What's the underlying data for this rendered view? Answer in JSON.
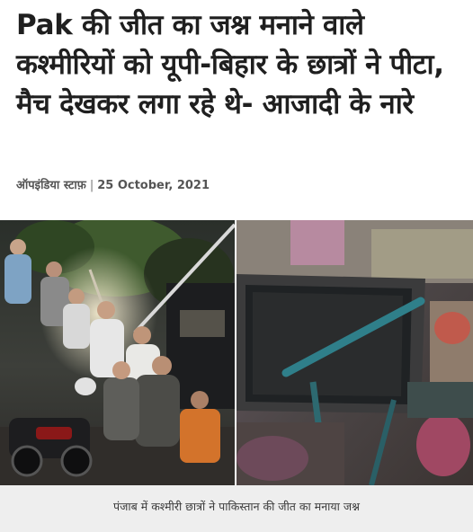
{
  "article": {
    "headline": "Pak की जीत का जश्न मनाने वाले कश्मीरियों को यूपी-बिहार के छात्रों ने पीटा, मैच देखकर लगा रहे थे- आजादी के नारे",
    "author": "ऑपइंडिया स्टाफ़",
    "separator": "|",
    "date": "25 October, 2021",
    "image_caption": "पंजाब में कश्मीरी छात्रों ने पाकिस्तान की जीत का मनाया जश्न"
  }
}
